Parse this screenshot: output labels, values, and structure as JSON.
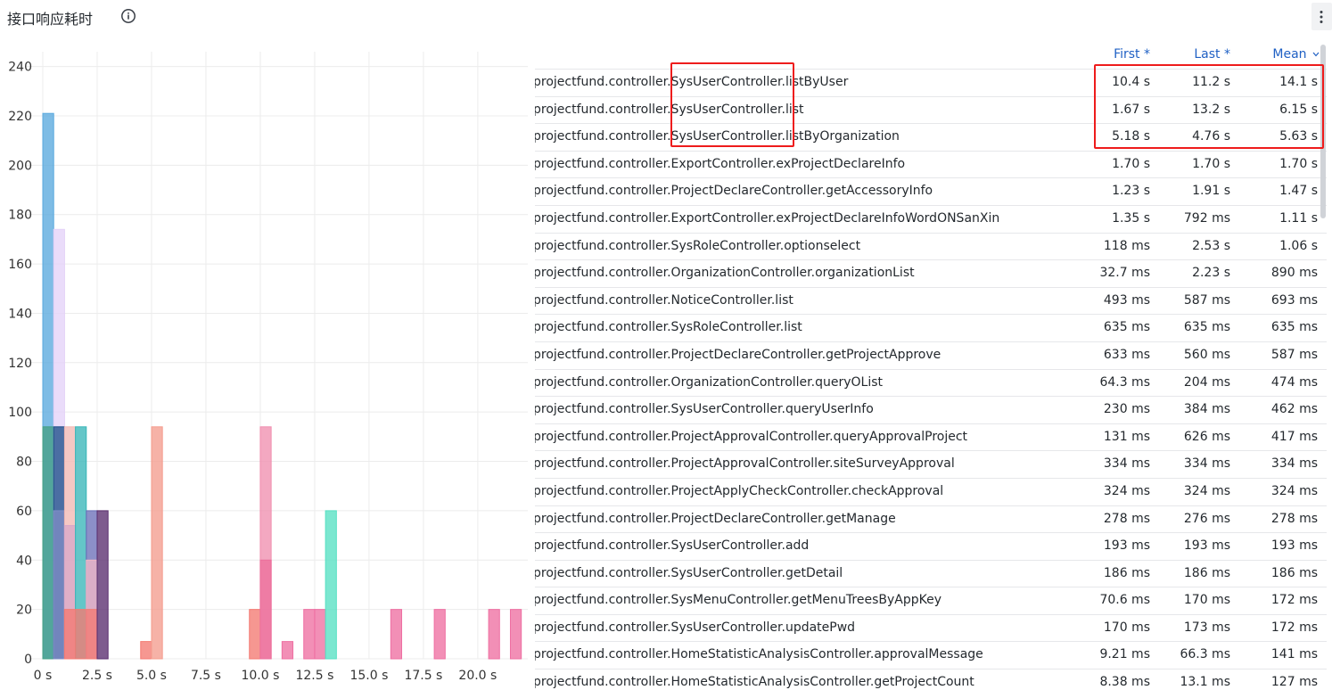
{
  "panel": {
    "title": "接口响应耗时",
    "info_icon": "info-circle-icon",
    "menu_icon": "kebab-menu-icon"
  },
  "table": {
    "headers": {
      "first": "First *",
      "last": "Last *",
      "mean": "Mean"
    },
    "sort_icon": "chevron-down-icon",
    "rows": [
      {
        "name": "projectfund.controller.SysUserController.listByUser",
        "first": "10.4 s",
        "last": "11.2 s",
        "mean": "14.1 s"
      },
      {
        "name": "projectfund.controller.SysUserController.list",
        "first": "1.67 s",
        "last": "13.2 s",
        "mean": "6.15 s"
      },
      {
        "name": "projectfund.controller.SysUserController.listByOrganization",
        "first": "5.18 s",
        "last": "4.76 s",
        "mean": "5.63 s"
      },
      {
        "name": "projectfund.controller.ExportController.exProjectDeclareInfo",
        "first": "1.70 s",
        "last": "1.70 s",
        "mean": "1.70 s"
      },
      {
        "name": "projectfund.controller.ProjectDeclareController.getAccessoryInfo",
        "first": "1.23 s",
        "last": "1.91 s",
        "mean": "1.47 s"
      },
      {
        "name": "projectfund.controller.ExportController.exProjectDeclareInfoWordONSanXin",
        "first": "1.35 s",
        "last": "792 ms",
        "mean": "1.11 s"
      },
      {
        "name": "projectfund.controller.SysRoleController.optionselect",
        "first": "118 ms",
        "last": "2.53 s",
        "mean": "1.06 s"
      },
      {
        "name": "projectfund.controller.OrganizationController.organizationList",
        "first": "32.7 ms",
        "last": "2.23 s",
        "mean": "890 ms"
      },
      {
        "name": "projectfund.controller.NoticeController.list",
        "first": "493 ms",
        "last": "587 ms",
        "mean": "693 ms"
      },
      {
        "name": "projectfund.controller.SysRoleController.list",
        "first": "635 ms",
        "last": "635 ms",
        "mean": "635 ms"
      },
      {
        "name": "projectfund.controller.ProjectDeclareController.getProjectApprove",
        "first": "633 ms",
        "last": "560 ms",
        "mean": "587 ms"
      },
      {
        "name": "projectfund.controller.OrganizationController.queryOList",
        "first": "64.3 ms",
        "last": "204 ms",
        "mean": "474 ms"
      },
      {
        "name": "projectfund.controller.SysUserController.queryUserInfo",
        "first": "230 ms",
        "last": "384 ms",
        "mean": "462 ms"
      },
      {
        "name": "projectfund.controller.ProjectApprovalController.queryApprovalProject",
        "first": "131 ms",
        "last": "626 ms",
        "mean": "417 ms"
      },
      {
        "name": "projectfund.controller.ProjectApprovalController.siteSurveyApproval",
        "first": "334 ms",
        "last": "334 ms",
        "mean": "334 ms"
      },
      {
        "name": "projectfund.controller.ProjectApplyCheckController.checkApproval",
        "first": "324 ms",
        "last": "324 ms",
        "mean": "324 ms"
      },
      {
        "name": "projectfund.controller.ProjectDeclareController.getManage",
        "first": "278 ms",
        "last": "276 ms",
        "mean": "278 ms"
      },
      {
        "name": "projectfund.controller.SysUserController.add",
        "first": "193 ms",
        "last": "193 ms",
        "mean": "193 ms"
      },
      {
        "name": "projectfund.controller.SysUserController.getDetail",
        "first": "186 ms",
        "last": "186 ms",
        "mean": "186 ms"
      },
      {
        "name": "projectfund.controller.SysMenuController.getMenuTreesByAppKey",
        "first": "70.6 ms",
        "last": "170 ms",
        "mean": "172 ms"
      },
      {
        "name": "projectfund.controller.SysUserController.updatePwd",
        "first": "170 ms",
        "last": "173 ms",
        "mean": "172 ms"
      },
      {
        "name": "projectfund.controller.HomeStatisticAnalysisController.approvalMessage",
        "first": "9.21 ms",
        "last": "66.3 ms",
        "mean": "141 ms"
      },
      {
        "name": "projectfund.controller.HomeStatisticAnalysisController.getProjectCount",
        "first": "8.38 ms",
        "last": "13.1 ms",
        "mean": "127 ms"
      }
    ]
  },
  "chart_data": {
    "type": "bar",
    "title": "",
    "xlabel": "",
    "ylabel": "",
    "xlim": [
      0,
      22.3
    ],
    "ylim": [
      0,
      246
    ],
    "x_ticks": [
      "0 s",
      "2.5 s",
      "5.0 s",
      "7.5 s",
      "10.0 s",
      "12.5 s",
      "15.0 s",
      "17.5 s",
      "20.0 s"
    ],
    "x_tick_values": [
      0,
      2.5,
      5.0,
      7.5,
      10.0,
      12.5,
      15.0,
      17.5,
      20.0
    ],
    "y_ticks": [
      0,
      20,
      40,
      60,
      80,
      100,
      120,
      140,
      160,
      180,
      200,
      220,
      240
    ],
    "bin_width": 0.5,
    "grid": true,
    "legend": "none",
    "bars": [
      {
        "x": 0.0,
        "value": 221,
        "color": "#5aa9de"
      },
      {
        "x": 0.0,
        "value": 94,
        "color": "#45a087"
      },
      {
        "x": 0.5,
        "value": 174,
        "color": "#e4d2f8"
      },
      {
        "x": 0.5,
        "value": 94,
        "color": "#1e4f8a"
      },
      {
        "x": 0.5,
        "value": 60,
        "color": "#7d8cc4"
      },
      {
        "x": 1.0,
        "value": 94,
        "color": "#f2b8b4"
      },
      {
        "x": 1.0,
        "value": 54,
        "color": "#d9a8c8"
      },
      {
        "x": 1.0,
        "value": 20,
        "color": "#f47a72"
      },
      {
        "x": 1.5,
        "value": 94,
        "color": "#38b6b8"
      },
      {
        "x": 1.5,
        "value": 20,
        "color": "#f47a72"
      },
      {
        "x": 2.0,
        "value": 60,
        "color": "#6b6fb8"
      },
      {
        "x": 2.0,
        "value": 40,
        "color": "#f0b7c6"
      },
      {
        "x": 2.0,
        "value": 20,
        "color": "#f47a72"
      },
      {
        "x": 2.5,
        "value": 60,
        "color": "#5a2d6e"
      },
      {
        "x": 4.5,
        "value": 7,
        "color": "#f47a72"
      },
      {
        "x": 5.0,
        "value": 94,
        "color": "#f49c8e"
      },
      {
        "x": 9.5,
        "value": 20,
        "color": "#f47a72"
      },
      {
        "x": 10.0,
        "value": 94,
        "color": "#f08fb0"
      },
      {
        "x": 10.0,
        "value": 40,
        "color": "#ec6f9c"
      },
      {
        "x": 11.0,
        "value": 7,
        "color": "#ee6fa2"
      },
      {
        "x": 12.0,
        "value": 20,
        "color": "#ee6fa2"
      },
      {
        "x": 12.5,
        "value": 20,
        "color": "#ee6fa2"
      },
      {
        "x": 13.0,
        "value": 60,
        "color": "#56e0c3"
      },
      {
        "x": 16.0,
        "value": 20,
        "color": "#ee6fa2"
      },
      {
        "x": 18.0,
        "value": 20,
        "color": "#ee6fa2"
      },
      {
        "x": 20.5,
        "value": 20,
        "color": "#ee6fa2"
      },
      {
        "x": 21.5,
        "value": 20,
        "color": "#ee6fa2"
      }
    ]
  },
  "highlights": {
    "color": "#ee1c1c"
  }
}
